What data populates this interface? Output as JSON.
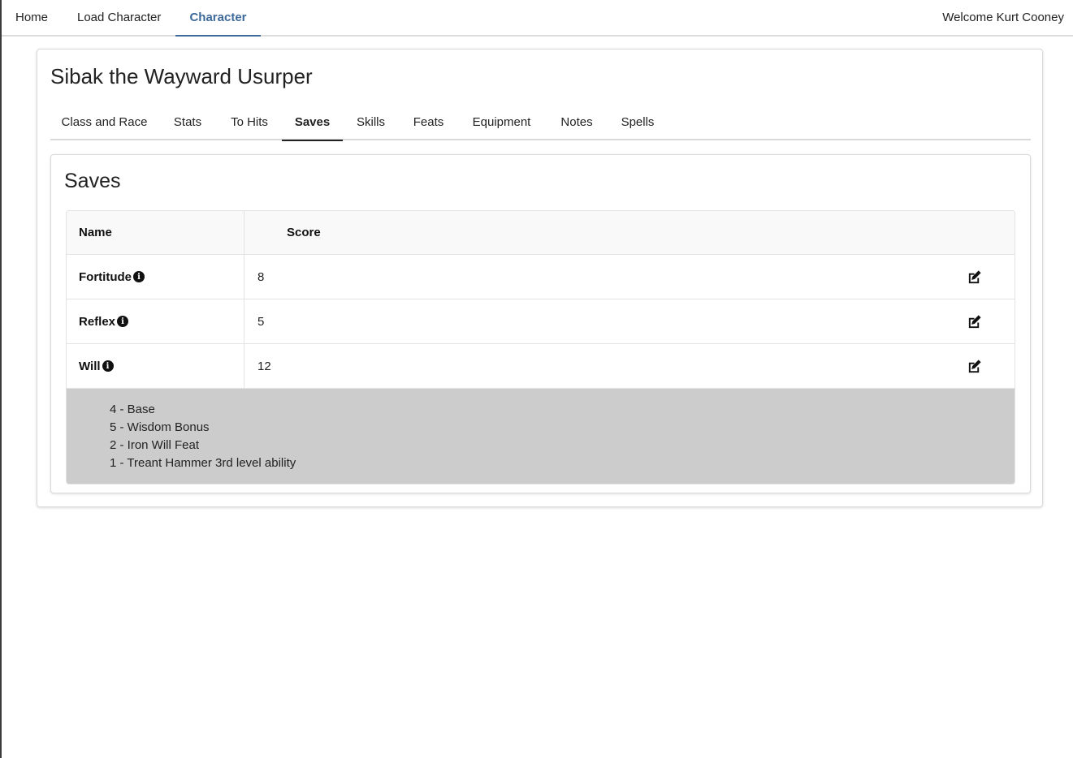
{
  "nav": {
    "items": [
      {
        "label": "Home"
      },
      {
        "label": "Load Character"
      },
      {
        "label": "Character"
      }
    ],
    "welcome": "Welcome Kurt Cooney"
  },
  "character": {
    "name": "Sibak the Wayward Usurper"
  },
  "tabs": [
    {
      "label": "Class and Race"
    },
    {
      "label": "Stats"
    },
    {
      "label": "To Hits"
    },
    {
      "label": "Saves"
    },
    {
      "label": "Skills"
    },
    {
      "label": "Feats"
    },
    {
      "label": "Equipment"
    },
    {
      "label": "Notes"
    },
    {
      "label": "Spells"
    }
  ],
  "active_tab": "Saves",
  "saves": {
    "title": "Saves",
    "columns": {
      "name": "Name",
      "score": "Score"
    },
    "rows": [
      {
        "name": "Fortitude",
        "score": "8"
      },
      {
        "name": "Reflex",
        "score": "5"
      },
      {
        "name": "Will",
        "score": "12"
      }
    ],
    "expanded_breakdown": [
      "4 - Base",
      "5 - Wisdom Bonus",
      "2 - Iron Will Feat",
      "1 - Treant Hammer 3rd level ability"
    ]
  },
  "icons": {
    "info": "info-circle-icon",
    "edit": "edit-icon"
  },
  "colors": {
    "accent": "#3d6a9a",
    "breakdown_bg": "#cccccc"
  }
}
